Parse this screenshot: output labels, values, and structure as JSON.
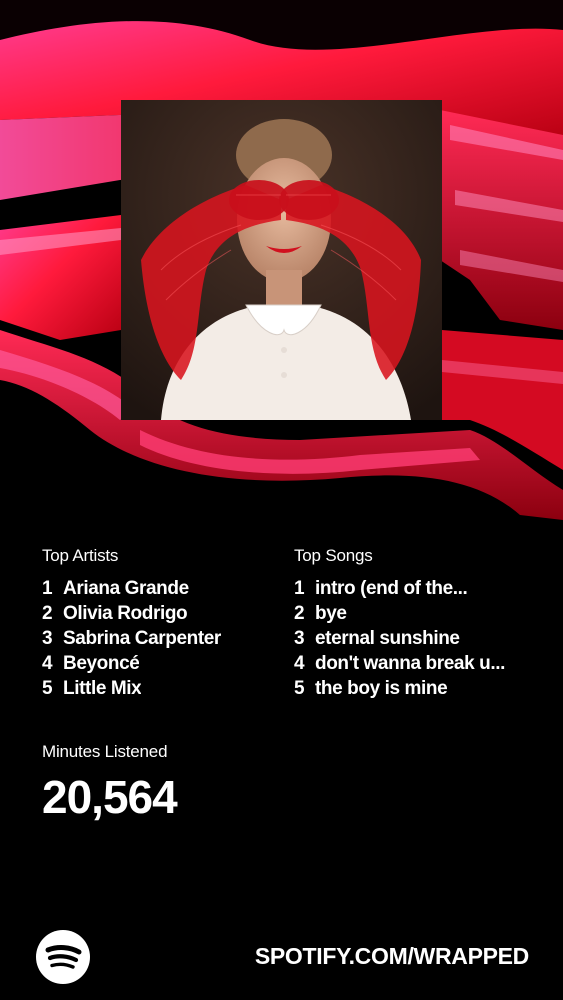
{
  "colors": {
    "background": "#000000",
    "text": "#ffffff",
    "accent_red": "#e8102a",
    "accent_pink": "#ff2f8a"
  },
  "album": {
    "icon": "album-cover-artwork"
  },
  "top_artists": {
    "label": "Top Artists",
    "items": [
      {
        "rank": "1",
        "name": "Ariana Grande"
      },
      {
        "rank": "2",
        "name": "Olivia Rodrigo"
      },
      {
        "rank": "3",
        "name": "Sabrina Carpenter"
      },
      {
        "rank": "4",
        "name": "Beyoncé"
      },
      {
        "rank": "5",
        "name": "Little Mix"
      }
    ]
  },
  "top_songs": {
    "label": "Top Songs",
    "items": [
      {
        "rank": "1",
        "name": "intro (end of the..."
      },
      {
        "rank": "2",
        "name": "bye"
      },
      {
        "rank": "3",
        "name": "eternal sunshine"
      },
      {
        "rank": "4",
        "name": "don't wanna break u..."
      },
      {
        "rank": "5",
        "name": "the boy is mine"
      }
    ]
  },
  "minutes": {
    "label": "Minutes Listened",
    "value": "20,564"
  },
  "footer": {
    "logo_icon": "spotify-logo-icon",
    "url": "SPOTIFY.COM/WRAPPED"
  }
}
